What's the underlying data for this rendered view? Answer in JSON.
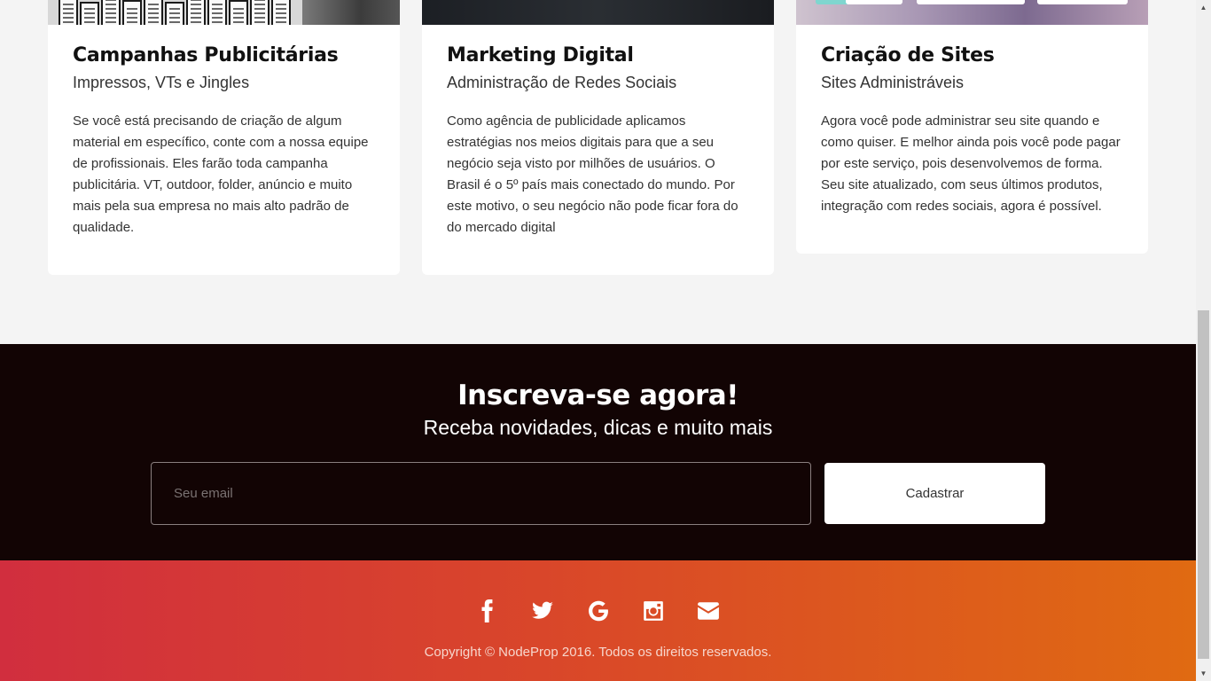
{
  "services": [
    {
      "title": "Campanhas Publicitárias",
      "subtitle": "Impressos, VTs e Jingles",
      "text": "Se você está precisando de criação de algum material em específico, conte com a nossa equipe de profissionais. Eles farão toda campanha publicitária. VT, outdoor, folder, anúncio e muito mais pela sua empresa no mais alto padrão de qualidade."
    },
    {
      "title": "Marketing Digital",
      "subtitle": "Administração de Redes Sociais",
      "text": "Como agência de publicidade aplicamos estratégias nos meios digitais para que a seu negócio seja visto por milhões de usuários. O Brasil é o 5º país mais conectado do mundo. Por este motivo, o seu negócio não pode ficar fora do do mercado digital"
    },
    {
      "title": "Criação de Sites",
      "subtitle": "Sites Administráveis",
      "text": "Agora você pode administrar seu site quando e como quiser. E melhor ainda pois você pode pagar por este serviço, pois desenvolvemos de forma. Seu site atualizado, com seus últimos produtos, integração com redes sociais, agora é possível."
    }
  ],
  "subscribe": {
    "title": "Inscreva-se agora!",
    "subtitle": "Receba novidades, dicas e muito mais",
    "email_placeholder": "Seu email",
    "button_label": "Cadastrar"
  },
  "footer": {
    "social_icons": [
      "facebook-icon",
      "twitter-icon",
      "google-icon",
      "instagram-icon",
      "envelope-icon"
    ],
    "copyright": "Copyright © NodeProp 2016. Todos os direitos reservados."
  },
  "colors": {
    "subscribe_bg": "#120404",
    "footer_gradient_start": "#d12e3e",
    "footer_gradient_end": "#e06a12",
    "section_bg": "#f4f4f4"
  }
}
